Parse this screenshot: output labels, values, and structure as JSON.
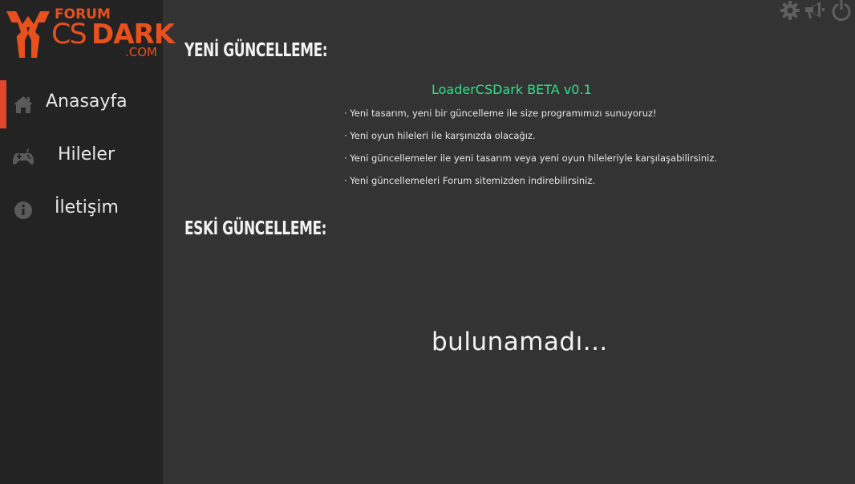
{
  "brand": {
    "forum": "FORUM",
    "cs": "CS",
    "dark": "DARK",
    "com": ".COM",
    "color": "#e8501e"
  },
  "sidebar": {
    "items": [
      {
        "label": "Anasayfa",
        "icon": "home-icon",
        "active": true
      },
      {
        "label": "Hileler",
        "icon": "gamepad-icon",
        "active": false
      },
      {
        "label": "İletişim",
        "icon": "info-icon",
        "active": false
      }
    ],
    "accent": "#e2472c"
  },
  "toolbar": {
    "icons": [
      "gear-icon",
      "megaphone-icon",
      "power-icon"
    ]
  },
  "main": {
    "new_update_title": "YENİ GÜNCELLEME:",
    "version_title": "LoaderCSDark BETA v0.1",
    "version_color": "#2ee088",
    "notes": [
      "· Yeni tasarım, yeni bir güncelleme ile size programımızı sunuyoruz!",
      "· Yeni oyun hileleri ile karşınızda olacağız.",
      "· Yeni güncellemeler ile yeni tasarım veya yeni oyun hileleriyle karşılaşabilirsiniz.",
      "· Yeni güncellemeleri Forum sitemizden indirebilirsiniz."
    ],
    "old_update_title": "ESKİ GÜNCELLEME:",
    "empty_text": "bulunamadı..."
  }
}
